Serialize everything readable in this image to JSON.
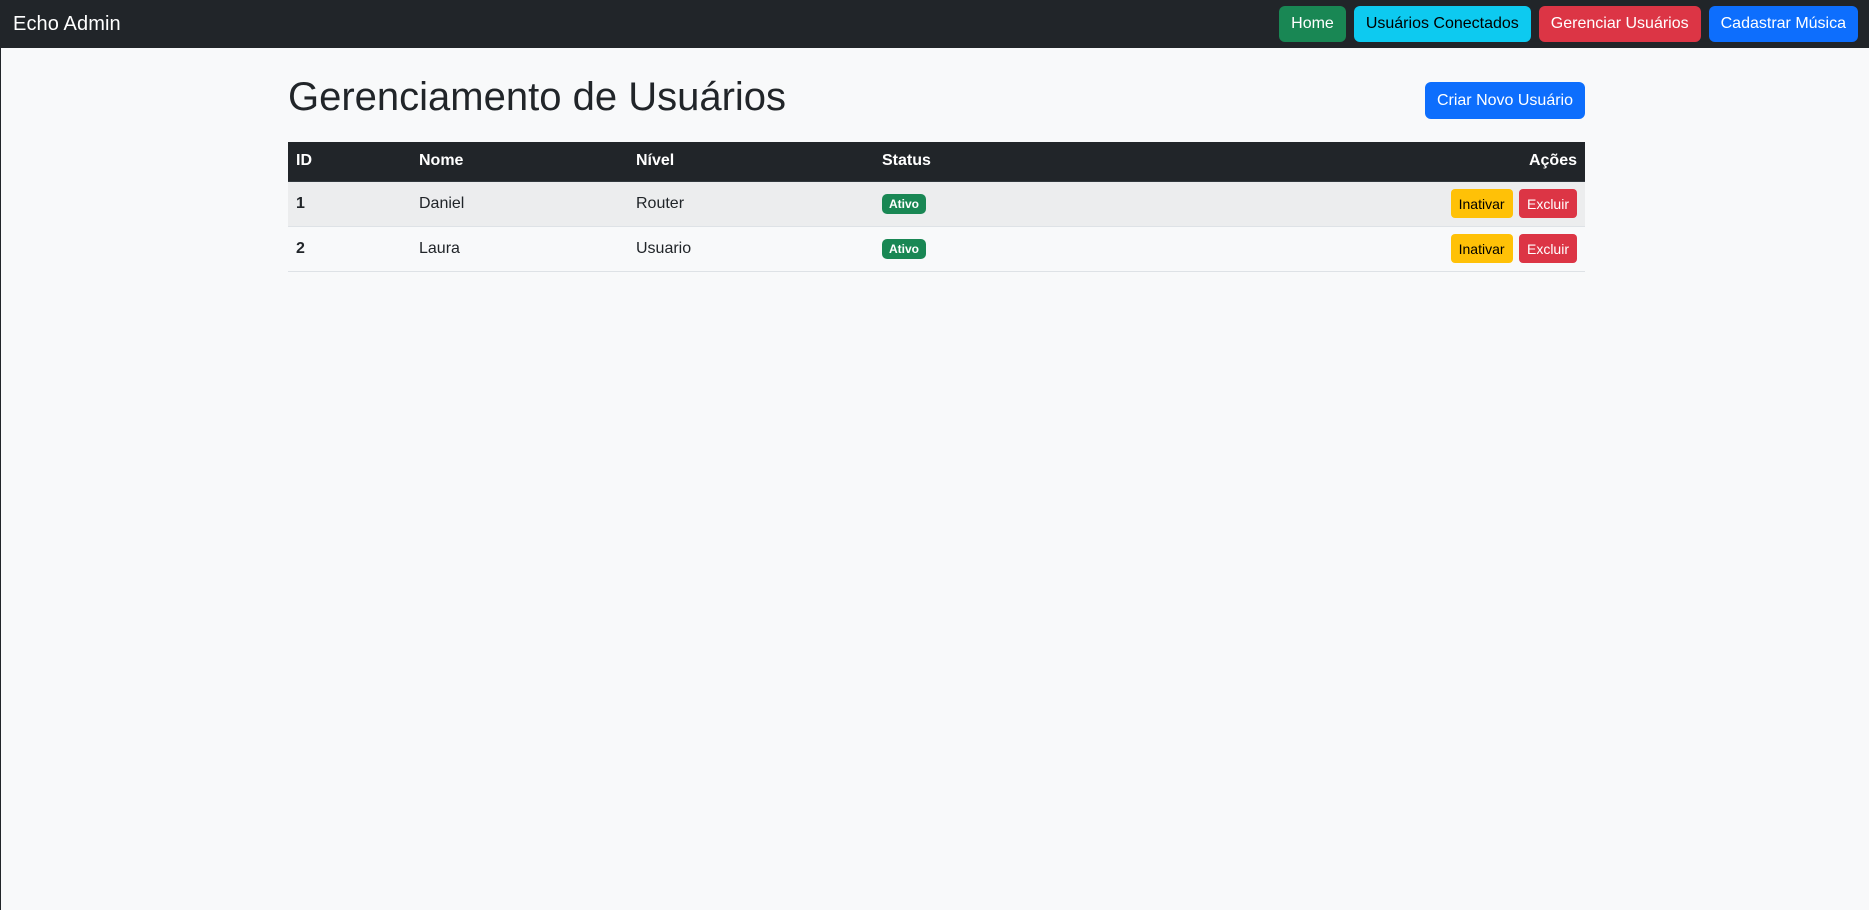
{
  "navbar": {
    "brand": "Echo Admin",
    "buttons": [
      {
        "label": "Home",
        "color": "#198754"
      },
      {
        "label": "Usuários Conectados",
        "color": "#0dcaf0"
      },
      {
        "label": "Gerenciar Usuários",
        "color": "#dc3545"
      },
      {
        "label": "Cadastrar Música",
        "color": "#0d6efd"
      }
    ]
  },
  "main": {
    "title": "Gerenciamento de Usuários",
    "create_button": "Criar Novo Usuário",
    "table": {
      "headers": [
        "ID",
        "Nome",
        "Nível",
        "Status",
        "Ações"
      ],
      "rows": [
        {
          "id": "1",
          "nome": "Daniel",
          "nivel": "Router",
          "status": "Ativo",
          "action_toggle": "Inativar",
          "action_delete": "Excluir"
        },
        {
          "id": "2",
          "nome": "Laura",
          "nivel": "Usuario",
          "status": "Ativo",
          "action_toggle": "Inativar",
          "action_delete": "Excluir"
        }
      ]
    }
  },
  "colors": {
    "navbar_bg": "#212529",
    "page_bg": "#f8f9fa",
    "status_active": "#198754",
    "warning": "#ffc107",
    "danger": "#dc3545",
    "primary": "#0d6efd"
  }
}
